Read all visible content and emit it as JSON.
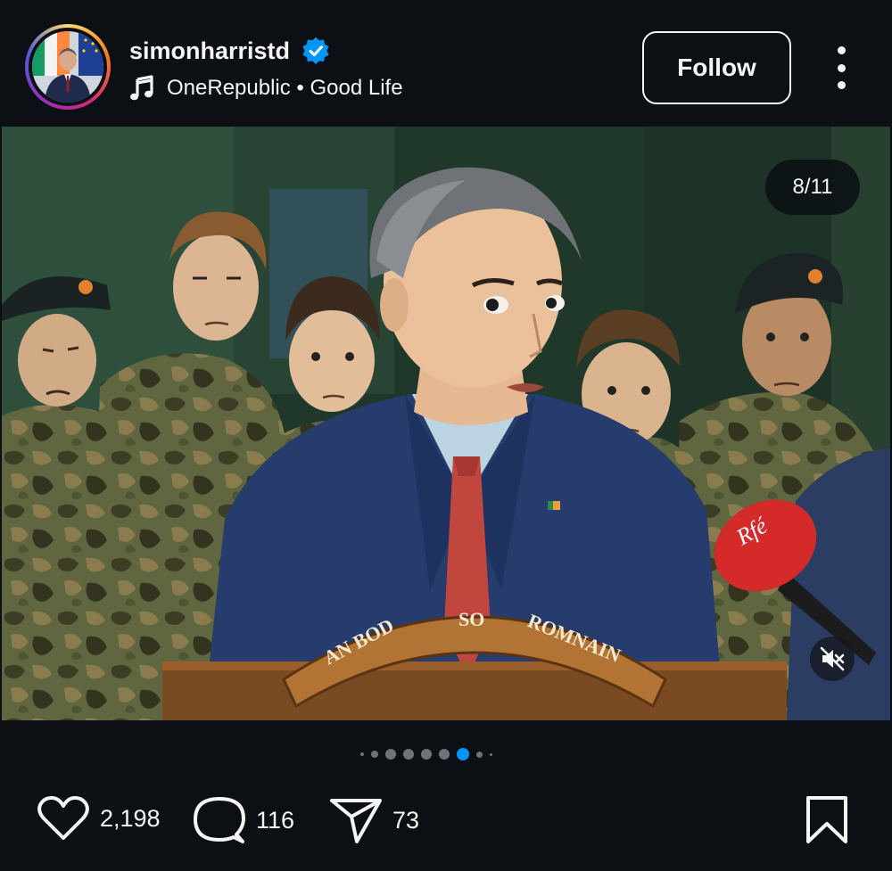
{
  "post": {
    "username": "simonharristd",
    "audio_artist": "OneRepublic",
    "audio_separator": "•",
    "audio_track": "Good Life",
    "follow_label": "Follow",
    "slide_counter": "8/11",
    "current_slide": 8,
    "total_slides": 11
  },
  "image_text": {
    "banner_words": [
      "AN BOD",
      "SO",
      "ROMNAIN"
    ],
    "mic_brand": "Rfé"
  },
  "carousel": {
    "visible_dots": 8,
    "active_dot_index": 5
  },
  "actions": {
    "likes": "2,198",
    "comments": "116",
    "shares": "73"
  },
  "icons": {
    "verified": "verified-badge-icon",
    "audio": "music-note-icon",
    "more": "more-options-icon",
    "mute": "muted-speaker-icon",
    "like": "heart-icon",
    "comment": "comment-bubble-icon",
    "share": "paper-plane-icon",
    "save": "bookmark-icon"
  },
  "colors": {
    "background": "#0c1014",
    "verified_blue": "#0095f6",
    "active_dot": "#0095f6",
    "inactive_dot": "#6e7379",
    "text": "#f5f5f5"
  }
}
